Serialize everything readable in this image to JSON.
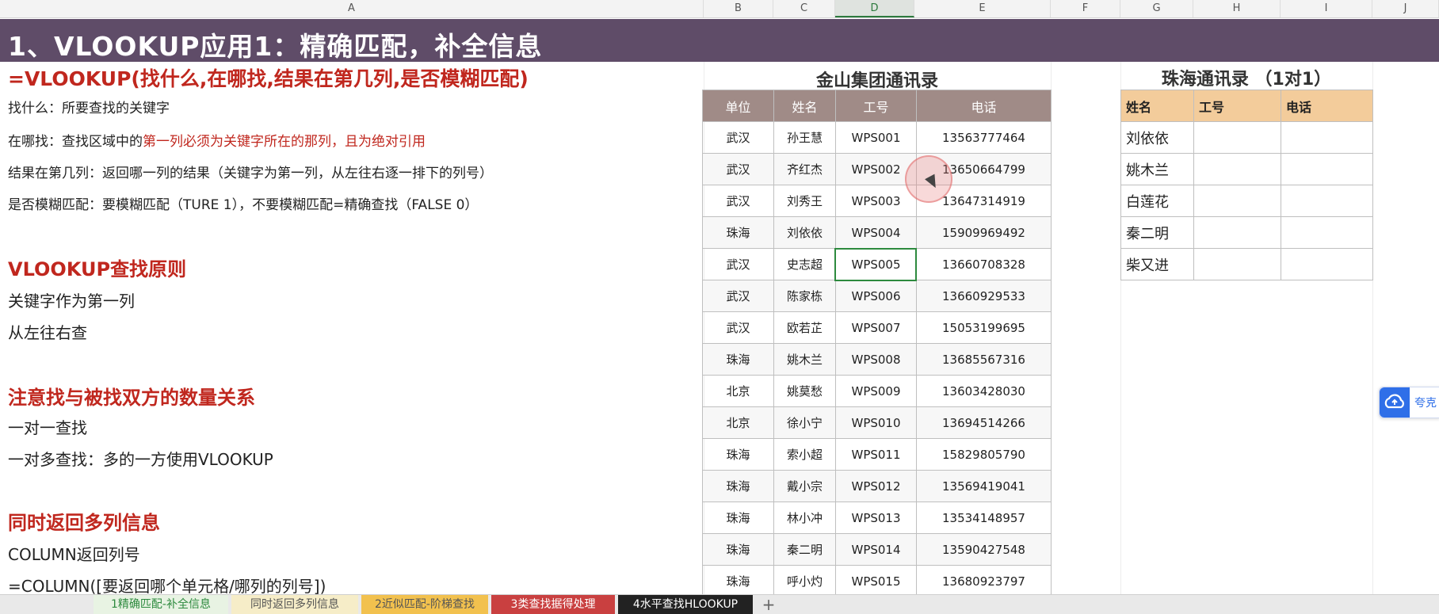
{
  "columns": [
    "A",
    "B",
    "C",
    "D",
    "E",
    "F",
    "G",
    "H",
    "I",
    "J"
  ],
  "selected_column": "D",
  "title": "1、VLOOKUP应用1：精确匹配，补全信息",
  "formula": "=VLOOKUP(找什么,在哪找,结果在第几列,是否模糊匹配)",
  "desc": {
    "l1": "找什么：所要查找的关键字",
    "l2_a": "在哪找：查找区域中的",
    "l2_b": "第一列必须为关键字所在的那列，且为绝对引用",
    "l3": "结果在第几列：返回哪一列的结果（关键字为第一列，从左往右逐一排下的列号）",
    "l4": "是否模糊匹配：要模糊匹配（TURE 1），不要模糊匹配=精确查找（FALSE 0）"
  },
  "principle": {
    "heading": "VLOOKUP查找原则",
    "l1": "关键字作为第一列",
    "l2": "从左往右查"
  },
  "quantity": {
    "heading": "注意找与被找双方的数量关系",
    "l1": "一对一查找",
    "l2": "一对多查找：多的一方使用VLOOKUP"
  },
  "multi": {
    "heading": "同时返回多列信息",
    "l1": "COLUMN返回列号",
    "l2": "=COLUMN([要返回哪个单元格/哪列的列号])"
  },
  "main_table": {
    "caption": "金山集团通讯录",
    "headers": [
      "单位",
      "姓名",
      "工号",
      "电话"
    ],
    "rows": [
      [
        "武汉",
        "孙王慧",
        "WPS001",
        "13563777464"
      ],
      [
        "武汉",
        "齐红杰",
        "WPS002",
        "13650664799"
      ],
      [
        "武汉",
        "刘秀王",
        "WPS003",
        "13647314919"
      ],
      [
        "珠海",
        "刘依依",
        "WPS004",
        "15909969492"
      ],
      [
        "武汉",
        "史志超",
        "WPS005",
        "13660708328"
      ],
      [
        "武汉",
        "陈家栋",
        "WPS006",
        "13660929533"
      ],
      [
        "武汉",
        "欧若芷",
        "WPS007",
        "15053199695"
      ],
      [
        "珠海",
        "姚木兰",
        "WPS008",
        "13685567316"
      ],
      [
        "北京",
        "姚莫愁",
        "WPS009",
        "13603428030"
      ],
      [
        "北京",
        "徐小宁",
        "WPS010",
        "13694514266"
      ],
      [
        "珠海",
        "索小超",
        "WPS011",
        "15829805790"
      ],
      [
        "珠海",
        "戴小宗",
        "WPS012",
        "13569419041"
      ],
      [
        "珠海",
        "林小冲",
        "WPS013",
        "13534148957"
      ],
      [
        "珠海",
        "秦二明",
        "WPS014",
        "13590427548"
      ],
      [
        "珠海",
        "呼小灼",
        "WPS015",
        "13680923797"
      ]
    ]
  },
  "side_table": {
    "caption": "珠海通讯录 （1对1）",
    "headers": [
      "姓名",
      "工号",
      "电话"
    ],
    "rows": [
      [
        "刘依依",
        "",
        ""
      ],
      [
        "姚木兰",
        "",
        ""
      ],
      [
        "白莲花",
        "",
        ""
      ],
      [
        "秦二明",
        "",
        ""
      ],
      [
        "柴又进",
        "",
        ""
      ]
    ]
  },
  "sheet_tabs": [
    {
      "label": "1精确匹配-补全信息",
      "bg": "#e8f3e3",
      "color": "#2d8a3e"
    },
    {
      "label": "同时返回多列信息",
      "bg": "#f6edc8",
      "color": "#555555"
    },
    {
      "label": "2近似匹配-阶梯查找",
      "bg": "#f2c14e",
      "color": "#555555"
    },
    {
      "label": "3类查找据得处理",
      "bg": "#c94040",
      "color": "#ffffff"
    },
    {
      "label": "4水平查找HLOOKUP",
      "bg": "#222222",
      "color": "#ffffff"
    }
  ],
  "add_sheet": "+",
  "cloud_label": "夸克",
  "colors": {
    "title_bg": "#5f4c68",
    "accent_red": "#c0271e",
    "main_header": "#a08b87",
    "side_header": "#f3cc9b"
  }
}
